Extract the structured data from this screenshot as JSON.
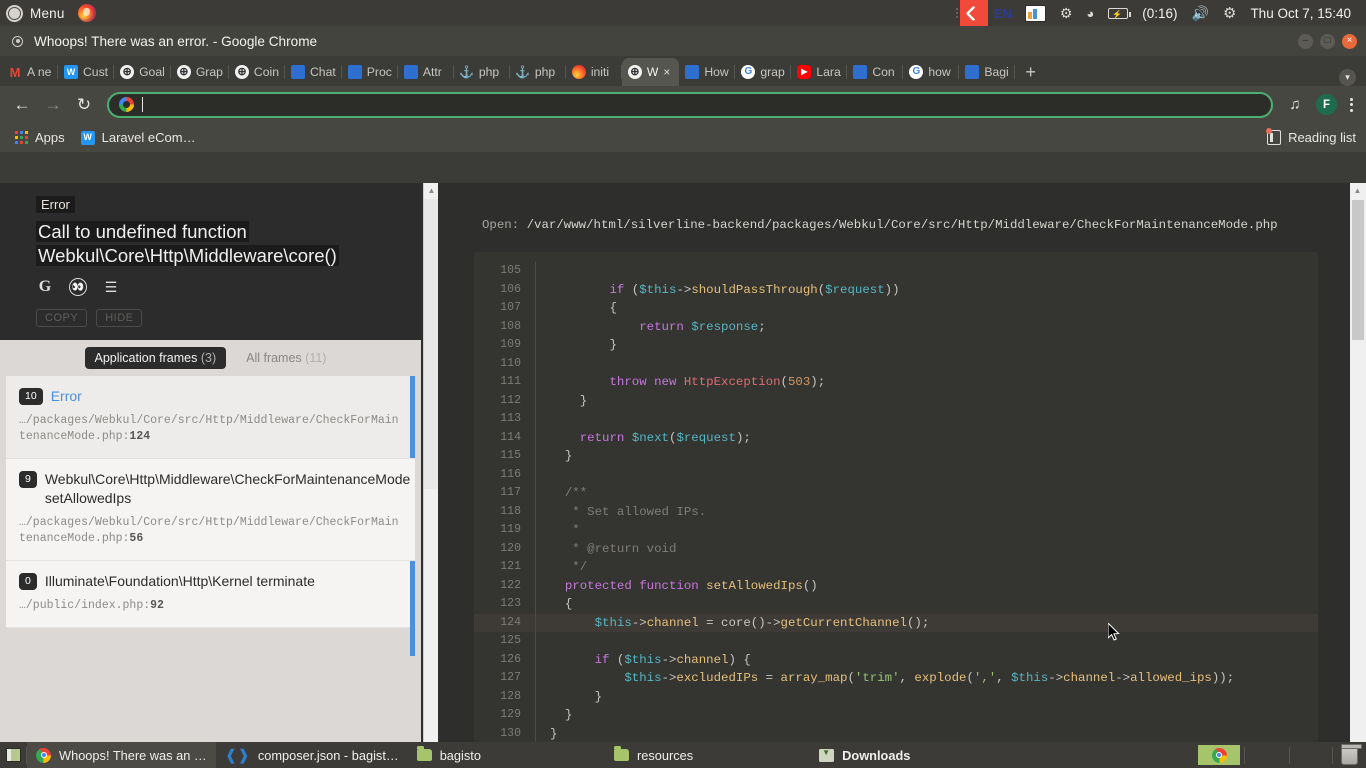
{
  "unity_panel": {
    "menu_label": "Menu",
    "ubuntu_icon": "ubuntu-logo-icon",
    "firefox_icon": "firefox-icon",
    "tray": {
      "workspace_icon": "workspace-switcher-icon",
      "keyboard_layout": "EN",
      "display_icon": "display-settings-icon",
      "bluetooth_icon": "bluetooth-icon",
      "wifi_icon": "wifi-icon",
      "battery_icon": "battery-icon",
      "battery_time": "(0:16)",
      "volume_icon": "volume-icon",
      "settings_icon": "gear-icon",
      "clock": "Thu Oct 7, 15:40"
    }
  },
  "chrome": {
    "window_title": "Whoops! There was an error. - Google Chrome",
    "window_buttons": {
      "minimize": "–",
      "maximize": "□",
      "close": "×"
    },
    "tabs": [
      {
        "label": "A ne",
        "favicon": "gmail-icon",
        "active": false
      },
      {
        "label": "Cust",
        "favicon": "app-icon",
        "active": false
      },
      {
        "label": "Goal",
        "favicon": "globe-icon",
        "active": false
      },
      {
        "label": "Grap",
        "favicon": "globe-icon",
        "active": false
      },
      {
        "label": "Coin",
        "favicon": "globe-icon",
        "active": false
      },
      {
        "label": "Chat",
        "favicon": "lock-icon",
        "active": false
      },
      {
        "label": "Proc",
        "favicon": "lock-icon",
        "active": false
      },
      {
        "label": "Attr",
        "favicon": "lock-icon",
        "active": false
      },
      {
        "label": "php",
        "favicon": "php-icon",
        "active": false
      },
      {
        "label": "php",
        "favicon": "php-icon",
        "active": false
      },
      {
        "label": "initi",
        "favicon": "gitlab-icon",
        "active": false
      },
      {
        "label": "W",
        "favicon": "globe-icon",
        "active": true
      },
      {
        "label": "How",
        "favicon": "lock-icon",
        "active": false
      },
      {
        "label": "grap",
        "favicon": "google-icon",
        "active": false
      },
      {
        "label": "Lara",
        "favicon": "youtube-icon",
        "active": false
      },
      {
        "label": "Con",
        "favicon": "lock-icon",
        "active": false
      },
      {
        "label": "how",
        "favicon": "google-icon",
        "active": false
      },
      {
        "label": "Bagi",
        "favicon": "lock-icon",
        "active": false
      }
    ],
    "new_tab_label": "+",
    "tab_search_icon": "chevron-down-icon",
    "toolbar": {
      "back_icon": "back-arrow-icon",
      "forward_icon": "forward-arrow-icon",
      "reload_icon": "reload-icon",
      "omnibox_value": "",
      "omnibox_placeholder": "",
      "omnibox_icon": "google-search-icon",
      "media_icon": "media-control-icon",
      "profile_initial": "F",
      "menu_icon": "kebab-menu-icon"
    },
    "bookmarks": {
      "apps_label": "Apps",
      "apps_icon": "apps-grid-icon",
      "items": [
        {
          "label": "Laravel eCom…",
          "favicon": "laravel-ecom-icon"
        }
      ],
      "reading_list_label": "Reading list",
      "reading_list_icon": "reading-list-icon"
    }
  },
  "ignition": {
    "exception_class": "Error",
    "exception_message_line1": "Call to undefined function",
    "exception_message_line2": "Webkul\\Core\\Http\\Middleware\\core()",
    "social": [
      {
        "name": "google-search-icon",
        "glyph": "G"
      },
      {
        "name": "duckduckgo-search-icon",
        "glyph": "ⓓ"
      },
      {
        "name": "stackoverflow-search-icon",
        "glyph": "☲"
      }
    ],
    "actions": [
      {
        "label": "COPY",
        "name": "copy-button"
      },
      {
        "label": "HIDE",
        "name": "hide-button"
      }
    ],
    "tabs": [
      {
        "label": "Application frames",
        "count": "(3)",
        "selected": true
      },
      {
        "label": "All frames",
        "count": "(11)",
        "selected": false
      }
    ],
    "frames": [
      {
        "number": "10",
        "name": "Error",
        "is_error": true,
        "path": "…/packages/Webkul/Core/src/Http/Middleware/CheckForMaintenanceMode.php:",
        "line": "124",
        "selected": true
      },
      {
        "number": "9",
        "name": "Webkul\\Core\\Http\\Middleware\\CheckForMaintenanceMode setAllowedIps",
        "is_error": false,
        "path": "…/packages/Webkul/Core/src/Http/Middleware/CheckForMaintenanceMode.php:",
        "line": "56",
        "selected": false
      },
      {
        "number": "0",
        "name": "Illuminate\\Foundation\\Http\\Kernel terminate",
        "is_error": false,
        "path": "…/public/index.php:",
        "line": "92",
        "selected": false
      }
    ]
  },
  "code_panel": {
    "open_label": "Open:",
    "open_path": "/var/www/html/silverline-backend/packages/Webkul/Core/src/Http/Middleware/CheckForMaintenanceMode.php",
    "highlight_line": 124,
    "lines": [
      {
        "n": "105",
        "text": ""
      },
      {
        "n": "106",
        "text": "        if ($this->shouldPassThrough($request))"
      },
      {
        "n": "107",
        "text": "        {"
      },
      {
        "n": "108",
        "text": "            return $response;"
      },
      {
        "n": "109",
        "text": "        }"
      },
      {
        "n": "110",
        "text": ""
      },
      {
        "n": "111",
        "text": "        throw new HttpException(503);"
      },
      {
        "n": "112",
        "text": "    }"
      },
      {
        "n": "113",
        "text": ""
      },
      {
        "n": "114",
        "text": "    return $next($request);"
      },
      {
        "n": "115",
        "text": "  }"
      },
      {
        "n": "116",
        "text": ""
      },
      {
        "n": "117",
        "text": "  /**"
      },
      {
        "n": "118",
        "text": "   * Set allowed IPs."
      },
      {
        "n": "119",
        "text": "   *"
      },
      {
        "n": "120",
        "text": "   * @return void"
      },
      {
        "n": "121",
        "text": "   */"
      },
      {
        "n": "122",
        "text": "  protected function setAllowedIps()"
      },
      {
        "n": "123",
        "text": "  {"
      },
      {
        "n": "124",
        "text": "      $this->channel = core()->getCurrentChannel();"
      },
      {
        "n": "125",
        "text": ""
      },
      {
        "n": "126",
        "text": "      if ($this->channel) {"
      },
      {
        "n": "127",
        "text": "          $this->excludedIPs = array_map('trim', explode(',', $this->channel->allowed_ips));"
      },
      {
        "n": "128",
        "text": "      }"
      },
      {
        "n": "129",
        "text": "  }"
      },
      {
        "n": "130",
        "text": "}"
      }
    ]
  },
  "taskbar": {
    "show_desktop_icon": "show-desktop-icon",
    "items": [
      {
        "label": "Whoops! There was an …",
        "icon": "chrome-icon",
        "active": true
      },
      {
        "label": "composer.json - bagist…",
        "icon": "vscode-icon",
        "active": false
      },
      {
        "label": "bagisto",
        "icon": "folder-icon",
        "active": false
      },
      {
        "label": "resources",
        "icon": "folder-icon",
        "active": false
      },
      {
        "label": "Downloads",
        "icon": "downloads-folder-icon",
        "active": false
      }
    ],
    "trash_icon": "trash-icon"
  },
  "colors": {
    "panel_bg": "#3c3b37",
    "chrome_toolbar": "#474741",
    "omnibox_focus": "#4caf70",
    "ignition_dark": "#2c2c2c",
    "ignition_light": "#f2f1f0",
    "frame_accent": "#4a90e2",
    "code_bg": "#343431",
    "code_highlight": "#3e3a35",
    "taskbar_bg": "#3c3b37"
  }
}
